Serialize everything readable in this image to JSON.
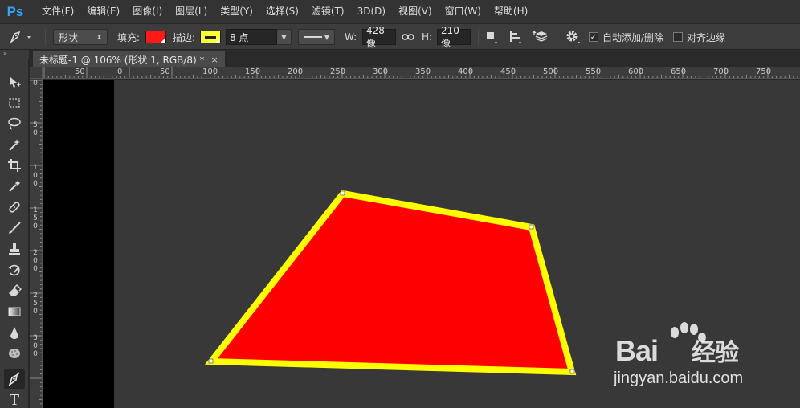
{
  "app": {
    "logo": "Ps"
  },
  "menu": [
    "文件(F)",
    "编辑(E)",
    "图像(I)",
    "图层(L)",
    "类型(Y)",
    "选择(S)",
    "滤镜(T)",
    "3D(D)",
    "视图(V)",
    "窗口(W)",
    "帮助(H)"
  ],
  "options": {
    "tool_icon": "pen-icon",
    "mode_value": "形状",
    "fill_label": "填充:",
    "fill_color": "#ff1a1a",
    "stroke_label": "描边:",
    "stroke_color": "#ffff33",
    "stroke_width_value": "8 点",
    "w_label": "W:",
    "w_value": "428 像",
    "h_label": "H:",
    "h_value": "210 像",
    "auto_add_delete_label": "自动添加/删除",
    "auto_add_delete_checked": true,
    "align_edges_label": "对齐边缘",
    "align_edges_checked": false
  },
  "document": {
    "tab_title": "未标题-1 @ 106% (形状 1, RGB/8) *",
    "close_glyph": "×"
  },
  "rulers": {
    "top_labels": [
      "50",
      "0",
      "50",
      "100",
      "150",
      "200",
      "250",
      "300",
      "350",
      "400",
      "450",
      "500",
      "550",
      "600",
      "650",
      "700",
      "750"
    ],
    "left_labels": [
      "0",
      "5 0",
      "1 0 0",
      "1 5 0",
      "2 0 0",
      "2 5 0",
      "3 0 0"
    ]
  },
  "shape": {
    "fill_color": "#ff0000",
    "stroke_color": "#ffff00",
    "anchor_color": "#ffffff"
  },
  "watermark": {
    "brand": "Bai",
    "brand_suffix": "经验",
    "url": "jingyan.baidu.com"
  }
}
